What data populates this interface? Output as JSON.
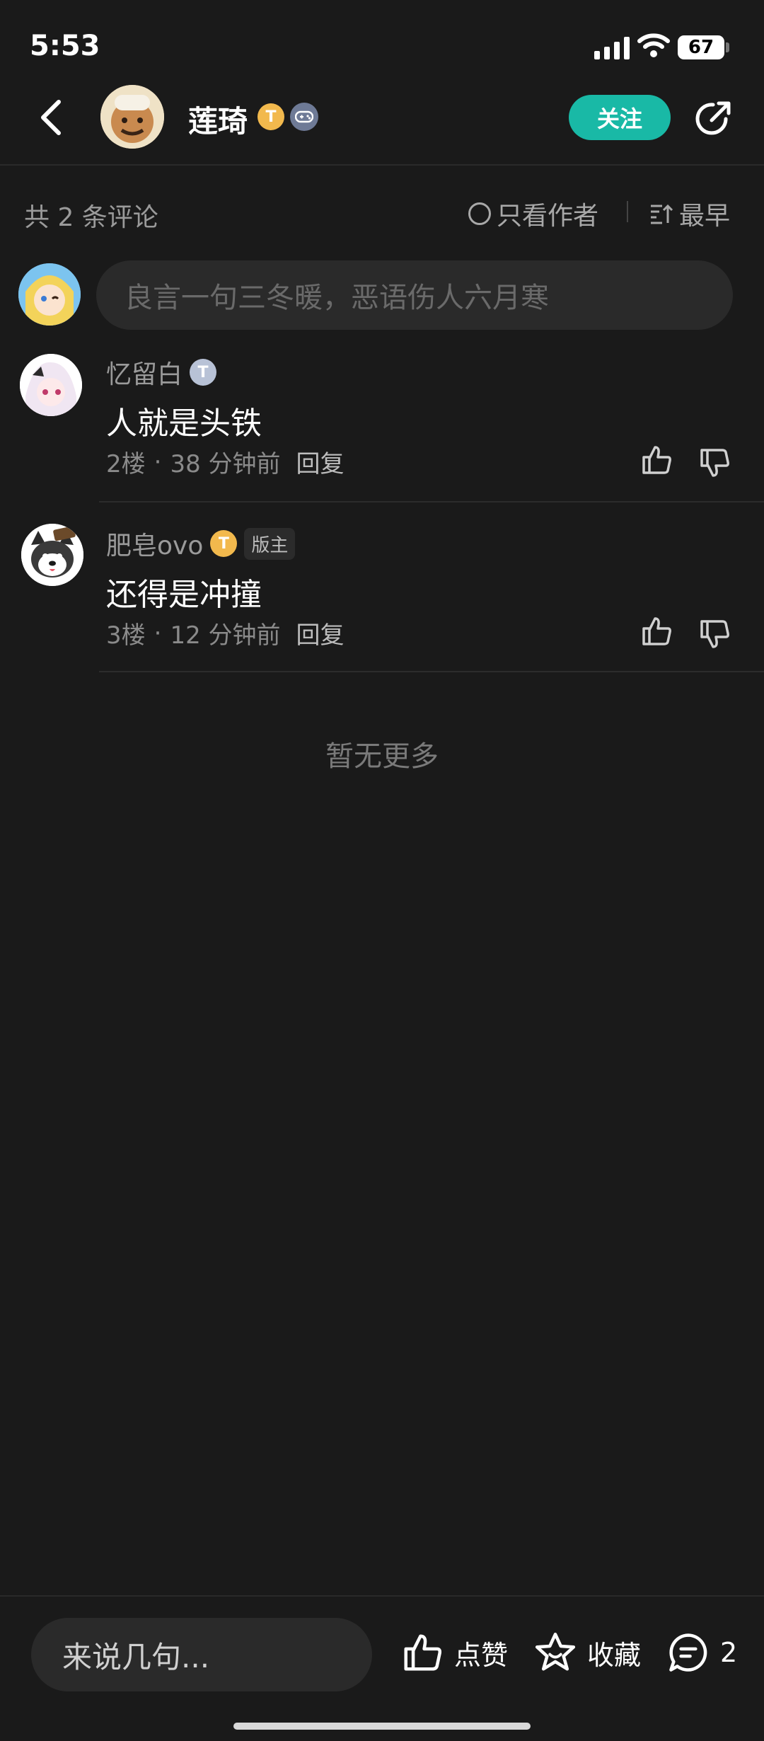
{
  "status_bar": {
    "time": "5:53",
    "battery": "67"
  },
  "header": {
    "author_name": "莲琦",
    "level_letter": "T",
    "follow_label": "关注"
  },
  "filter_bar": {
    "comment_count": "共 2 条评论",
    "author_only": "只看作者",
    "sort": "最早"
  },
  "composer": {
    "placeholder": "良言一句三冬暖，恶语伤人六月寒"
  },
  "comments": [
    {
      "username": "忆留白",
      "level_letter": "T",
      "text": "人就是头铁",
      "floor": "2楼",
      "time": "38 分钟前",
      "reply": "回复"
    },
    {
      "username": "肥皂ovo",
      "level_letter": "T",
      "role": "版主",
      "text": "还得是冲撞",
      "floor": "3楼",
      "time": "12 分钟前",
      "reply": "回复"
    }
  ],
  "no_more": "暂无更多",
  "bottom_bar": {
    "input_placeholder": "来说几句...",
    "like": "点赞",
    "favorite": "收藏",
    "comment_count": "2"
  },
  "colors": {
    "accent": "#19b9a6",
    "background": "#1a1a1a",
    "gold_badge": "#f2b94d"
  }
}
